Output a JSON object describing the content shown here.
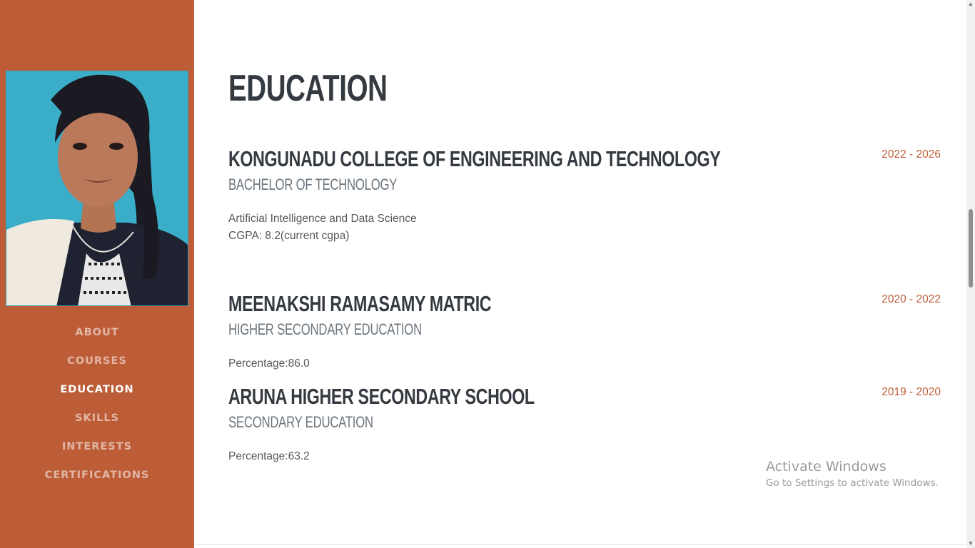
{
  "sidebar": {
    "photo_alt": "profile photo",
    "nav": [
      {
        "label": "About",
        "active": false
      },
      {
        "label": "Courses",
        "active": false
      },
      {
        "label": "Education",
        "active": true
      },
      {
        "label": "Skills",
        "active": false
      },
      {
        "label": "Interests",
        "active": false
      },
      {
        "label": "Certifications",
        "active": false
      }
    ]
  },
  "education": {
    "title": "EDUCATION",
    "entries": [
      {
        "institution": "KONGUNADU COLLEGE OF ENGINEERING AND TECHNOLOGY",
        "degree": "BACHELOR OF TECHNOLOGY",
        "details": [
          "Artificial Intelligence and Data Science",
          "CGPA: 8.2(current cgpa)"
        ],
        "dates": "2022 - 2026"
      },
      {
        "institution": "MEENAKSHI RAMASAMY MATRIC",
        "degree": "HIGHER SECONDARY EDUCATION",
        "details": [
          "Percentage:86.0"
        ],
        "dates": "2020 - 2022"
      },
      {
        "institution": "ARUNA HIGHER SECONDARY SCHOOL",
        "degree": "SECONDARY EDUCATION",
        "details": [
          "Percentage:63.2"
        ],
        "dates": "2019 - 2020"
      }
    ]
  },
  "watermark": {
    "title": "Activate Windows",
    "subtitle": "Go to Settings to activate Windows."
  },
  "colors": {
    "primary": "#bd5d38",
    "heading": "#343a40",
    "subheading": "#6c757d"
  }
}
